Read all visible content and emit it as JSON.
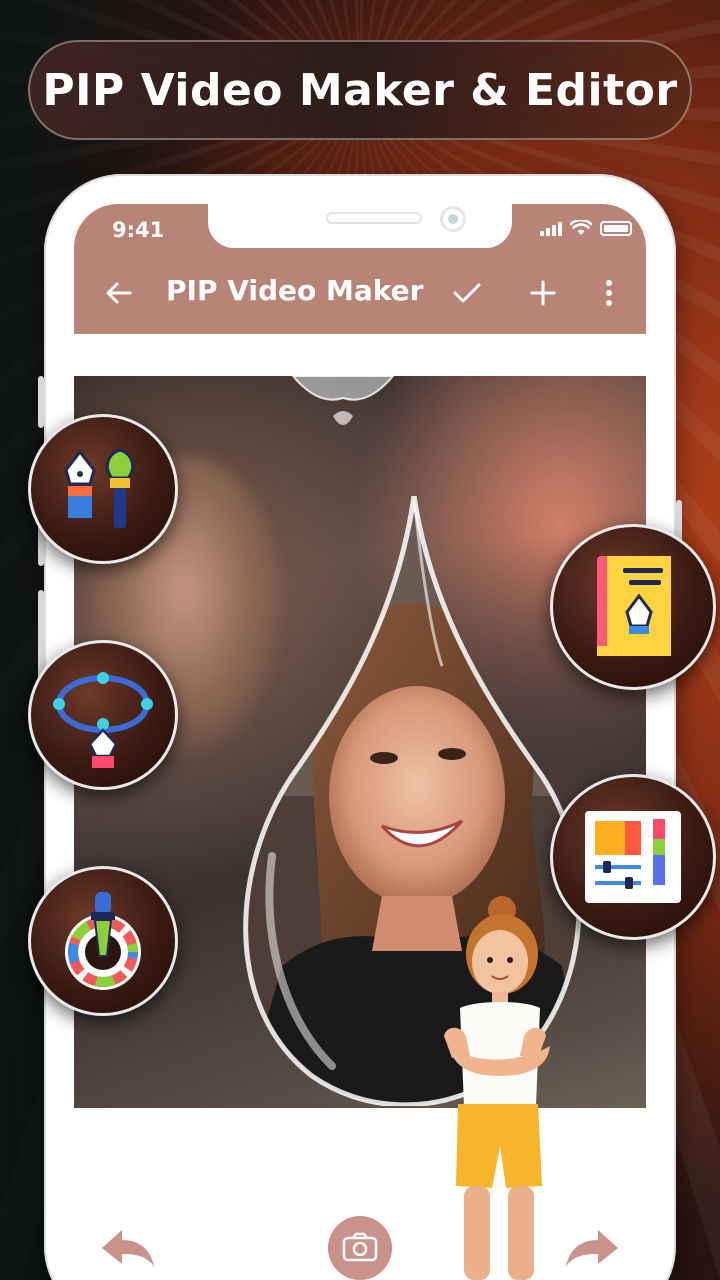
{
  "banner": {
    "title": "PIP Video Maker & Editor"
  },
  "status_bar": {
    "time": "9:41"
  },
  "toolbar": {
    "title": "PIP Video Maker"
  },
  "icons": {
    "back": "arrow-left-icon",
    "confirm": "check-icon",
    "add": "plus-icon",
    "menu": "more-vertical-icon",
    "camera": "camera-icon"
  },
  "features": [
    {
      "name": "pen-brush-tool",
      "icon": "pen-brush-icon"
    },
    {
      "name": "vector-path-tool",
      "icon": "bezier-pen-icon"
    },
    {
      "name": "color-picker-tool",
      "icon": "color-wheel-icon"
    },
    {
      "name": "design-book-tool",
      "icon": "design-book-icon"
    },
    {
      "name": "adjust-panel-tool",
      "icon": "sliders-panel-icon"
    }
  ],
  "colors": {
    "toolbar": "#b98478",
    "accent_red": "#c0451c",
    "white": "#ffffff"
  }
}
